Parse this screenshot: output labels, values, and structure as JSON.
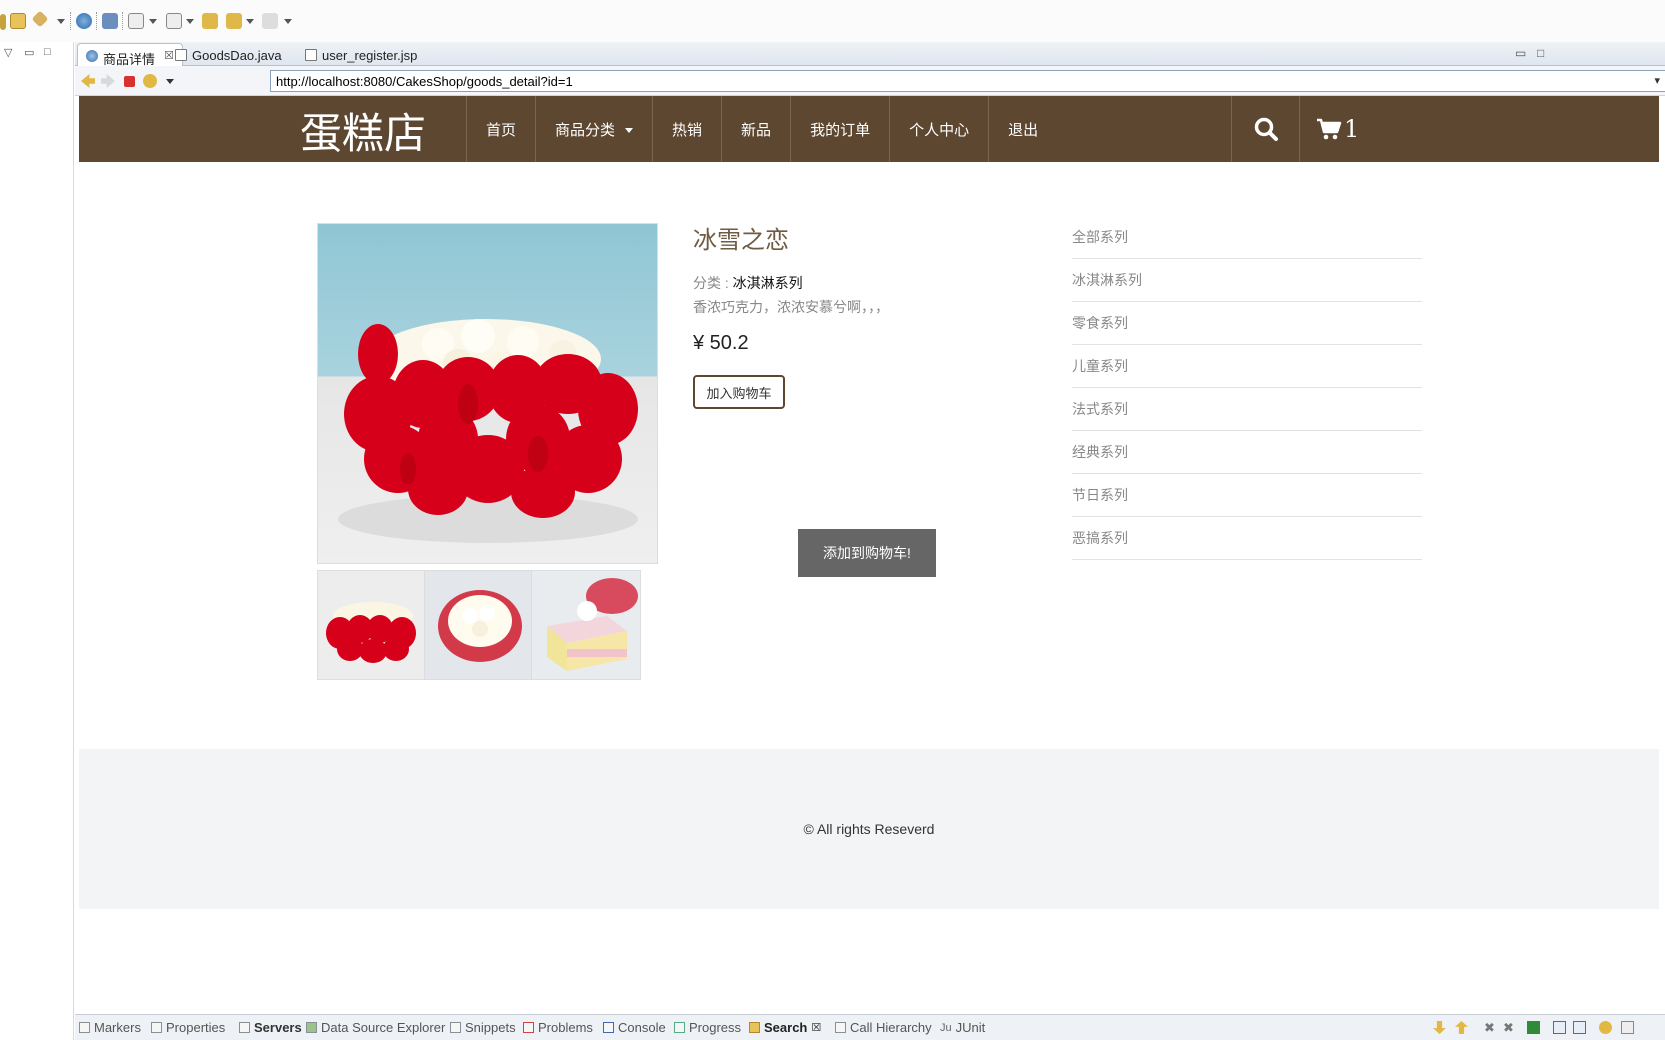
{
  "ide": {
    "editor_tabs": [
      {
        "label": "商品详情",
        "close": "☒"
      },
      {
        "label": "GoodsDao.java"
      },
      {
        "label": "user_register.jsp"
      }
    ],
    "url": "http://localhost:8080/CakesShop/goods_detail?id=1",
    "views": [
      {
        "label": "Markers"
      },
      {
        "label": "Properties"
      },
      {
        "label": "Servers"
      },
      {
        "label": "Data Source Explorer"
      },
      {
        "label": "Snippets"
      },
      {
        "label": "Problems"
      },
      {
        "label": "Console"
      },
      {
        "label": "Progress"
      },
      {
        "label": "Search",
        "close": "☒"
      },
      {
        "label": "Call Hierarchy"
      },
      {
        "label": "JUnit"
      }
    ]
  },
  "site": {
    "logo": "蛋糕店",
    "nav": [
      "首页",
      "商品分类",
      "热销",
      "新品",
      "我的订单",
      "个人中心",
      "退出"
    ],
    "cart_count": "1"
  },
  "product": {
    "title": "冰雪之恋",
    "category_label": "分类 : ",
    "category_value": "冰淇淋系列",
    "description": "香浓巧克力，浓浓安慕兮啊，，，",
    "price": "¥ 50.2",
    "add_to_cart": "加入购物车",
    "toast": "添加到购物车!"
  },
  "categories": [
    "全部系列",
    "冰淇淋系列",
    "零食系列",
    "儿童系列",
    "法式系列",
    "经典系列",
    "节日系列",
    "恶搞系列"
  ],
  "footer": "© All rights Reseverd",
  "colors": {
    "header_brown": "#5d4730",
    "footer_bg": "#f2f4f5",
    "toast_bg": "#666666"
  }
}
